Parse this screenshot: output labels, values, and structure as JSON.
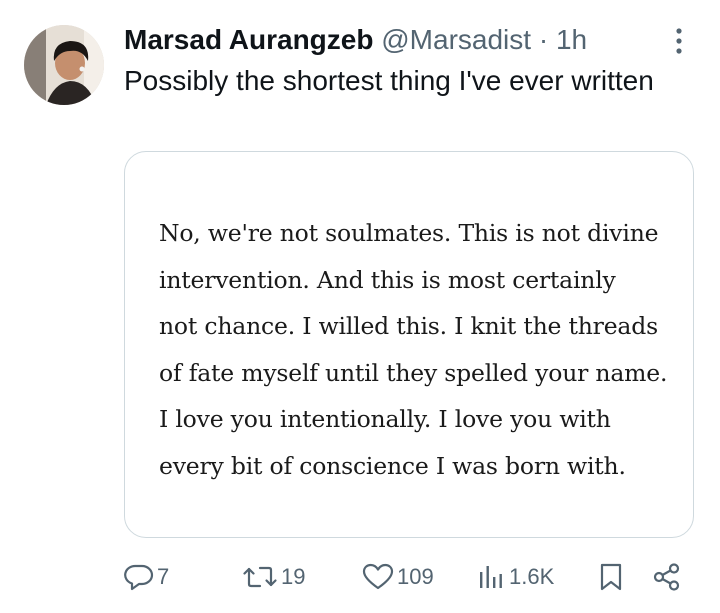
{
  "tweet": {
    "author_name": "Marsad Aurangzeb",
    "handle": "@Marsadist",
    "separator": "·",
    "time": "1h",
    "text": "Possibly the shortest thing I've ever written"
  },
  "image_text": {
    "lines": [
      "No, we're not soulmates. This is not divine",
      "intervention. And this is most certainly",
      "not chance. I willed this. I knit the threads",
      "of fate myself until they spelled your name.",
      "I love you intentionally. I love you with",
      "every bit of conscience I was born with."
    ]
  },
  "actions": {
    "replies": "7",
    "reposts": "19",
    "likes": "109",
    "views": "1.6K"
  },
  "colors": {
    "text_primary": "#0f1419",
    "text_secondary": "#536471",
    "border": "#cfd9de"
  },
  "icons": [
    "more-icon",
    "reply-icon",
    "repost-icon",
    "like-icon",
    "views-icon",
    "bookmark-icon",
    "share-icon"
  ]
}
